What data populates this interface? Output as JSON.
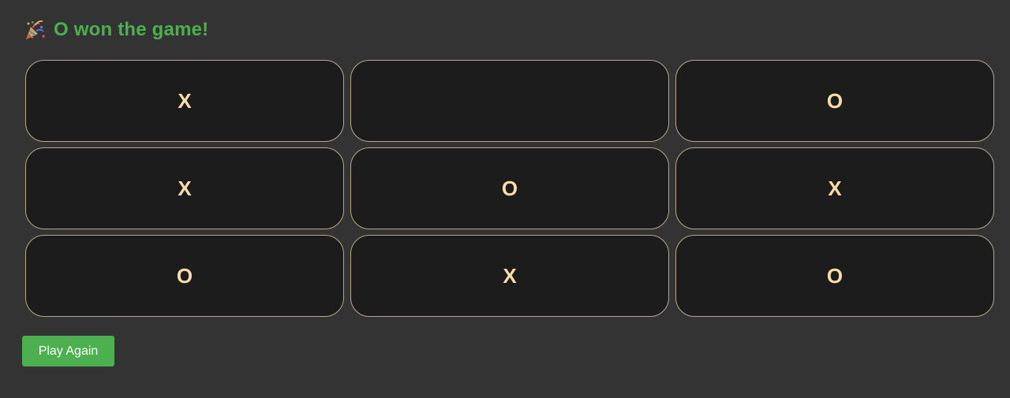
{
  "status": {
    "icon": "party-popper-icon",
    "message": "O won the game!",
    "color": "#4caf50"
  },
  "board": {
    "cells": [
      [
        "X",
        "",
        "O"
      ],
      [
        "X",
        "O",
        "X"
      ],
      [
        "O",
        "X",
        "O"
      ]
    ]
  },
  "controls": {
    "play_again_label": "Play Again",
    "button_color": "#4caf50"
  },
  "colors": {
    "background": "#333333",
    "cell_background": "#1c1c1c",
    "cell_border": "#b7a88a",
    "mark": "#f8dcaa"
  }
}
